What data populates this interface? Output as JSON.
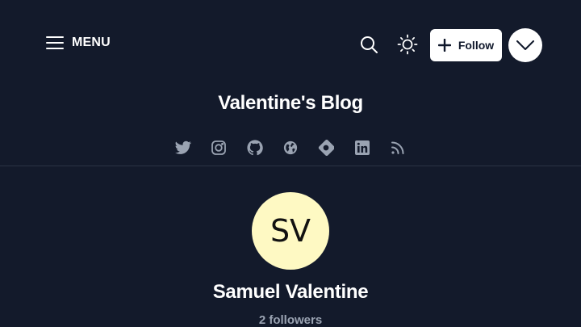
{
  "header": {
    "menu_label": "MENU",
    "follow_label": "Follow"
  },
  "blog": {
    "title": "Valentine's Blog"
  },
  "socials": [
    {
      "name": "twitter-icon"
    },
    {
      "name": "instagram-icon"
    },
    {
      "name": "github-icon"
    },
    {
      "name": "globe-icon"
    },
    {
      "name": "hashnode-icon"
    },
    {
      "name": "linkedin-icon"
    },
    {
      "name": "rss-icon"
    }
  ],
  "author": {
    "initials": "SV",
    "name": "Samuel Valentine",
    "followers": "2 followers"
  },
  "colors": {
    "background": "#131a2b",
    "avatar_bg": "#fef9c3",
    "icon_muted": "#9aa3b2"
  }
}
